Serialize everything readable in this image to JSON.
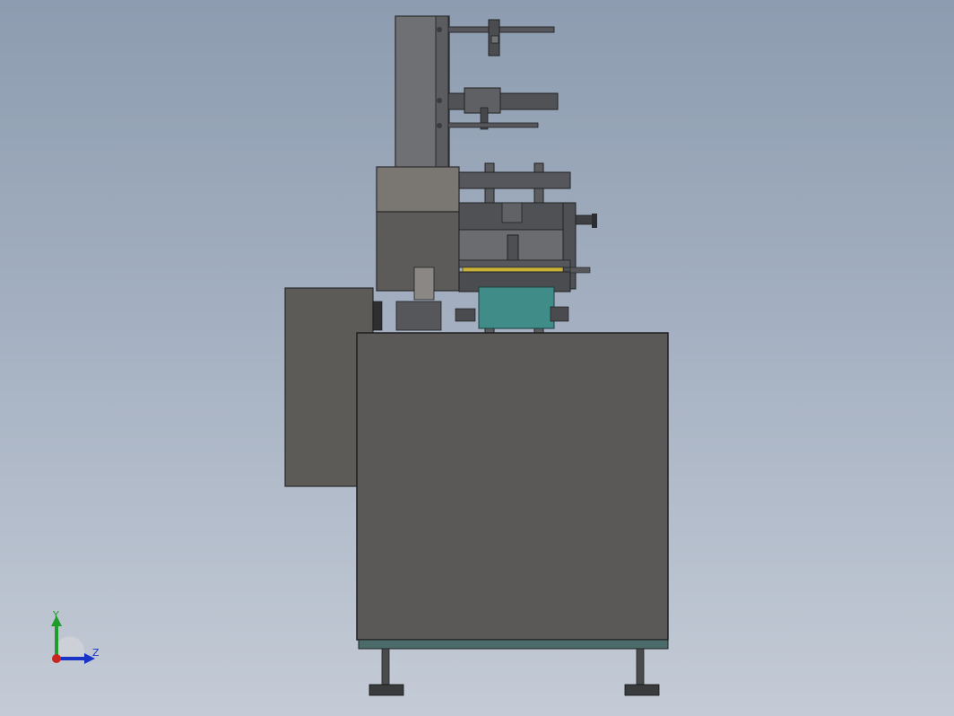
{
  "scene": {
    "model": "packaging-machine",
    "view": "side",
    "colors": {
      "background_top": "#8d9cb0",
      "background_bottom": "#c4cbd6",
      "cabinet": "#5b5957",
      "upper_plate": "#6e7073",
      "mechanism": "#54565b",
      "teal_block": "#3f8c88",
      "accent_yellow": "#c9b23a"
    }
  },
  "triad": {
    "y_label": "Y",
    "z_label": "Z",
    "y_color": "#1f9c2a",
    "z_color": "#1b34c8",
    "x_color": "#c8261f"
  }
}
